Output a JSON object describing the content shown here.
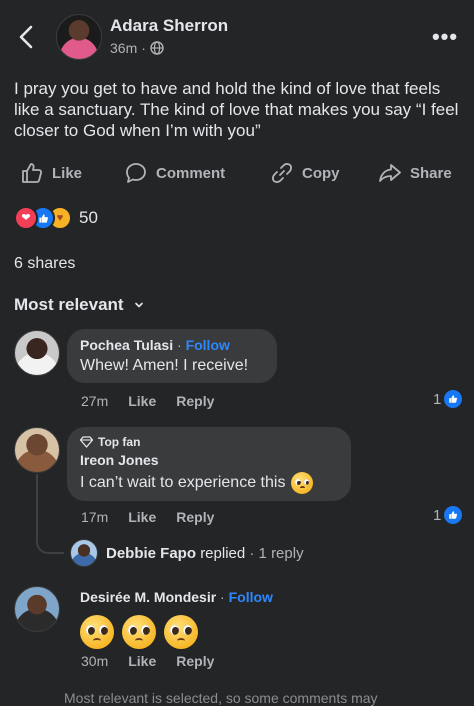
{
  "post": {
    "author": "Adara Sherron",
    "time": "36m",
    "dot": "·",
    "text": "I pray you get to have and hold the kind of love that feels like a sanctuary. The kind of love that makes you say “I feel closer to God when I’m with you”",
    "more_icon": "ellipsis-icon"
  },
  "actions": {
    "like": "Like",
    "comment": "Comment",
    "copy": "Copy",
    "share": "Share"
  },
  "reactions": {
    "count": "50",
    "types": [
      "love",
      "like",
      "care"
    ]
  },
  "shares": "6 shares",
  "sort": {
    "label": "Most relevant"
  },
  "comments": [
    {
      "name": "Pochea Tulasi",
      "follow": "Follow",
      "dot": "·",
      "text": "Whew! Amen! I receive!",
      "time": "27m",
      "like": "Like",
      "reply": "Reply",
      "likes": "1"
    },
    {
      "badge": "Top fan",
      "name": "Ireon Jones",
      "text": "I can’t wait to experience this",
      "time": "17m",
      "like": "Like",
      "reply": "Reply",
      "likes": "1",
      "reply_preview": {
        "name": "Debbie Fapo",
        "action": "replied",
        "count": "· 1 reply"
      }
    },
    {
      "name": "Desirée M. Mondesir",
      "follow": "Follow",
      "dot": "·",
      "emoji_count": 3,
      "time": "30m",
      "like": "Like",
      "reply": "Reply"
    }
  ],
  "footer": "Most relevant is selected, so some comments may",
  "colors": {
    "background": "#242526",
    "bubble": "#3a3b3c",
    "accent": "#2d88ff",
    "secondary_text": "#b0b3b8"
  }
}
